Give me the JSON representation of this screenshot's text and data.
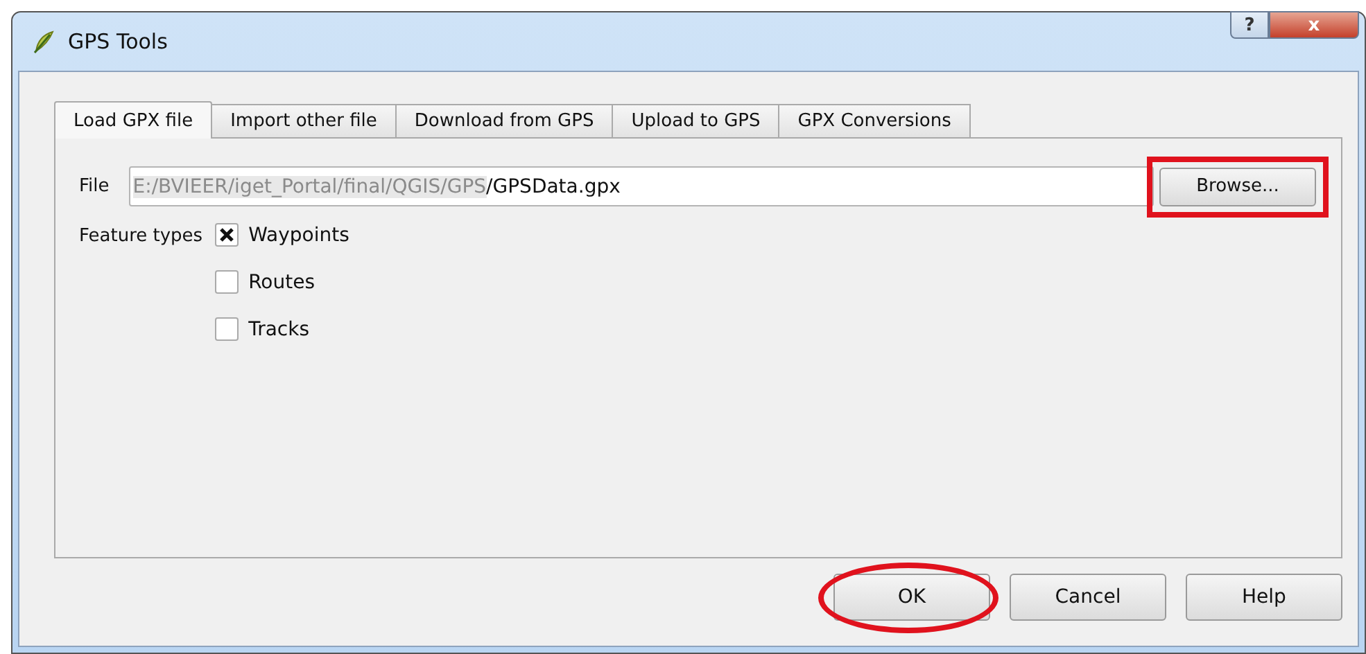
{
  "window": {
    "title": "GPS Tools",
    "controls": [
      {
        "kind": "help",
        "label": "?"
      },
      {
        "kind": "close",
        "label": "x"
      }
    ]
  },
  "tabs": [
    {
      "label": "Load GPX file",
      "selected": true
    },
    {
      "label": "Import other file",
      "selected": false
    },
    {
      "label": "Download from GPS",
      "selected": false
    },
    {
      "label": "Upload to GPS",
      "selected": false
    },
    {
      "label": "GPX Conversions",
      "selected": false
    }
  ],
  "file": {
    "label": "File",
    "value_dimmed": "E:/BVIEER/iget_Portal/final/QGIS/GPS",
    "value": "/GPSData.gpx",
    "button": {
      "label": "Browse...",
      "boxed": true
    }
  },
  "feature_types": {
    "label": "Feature types",
    "options": [
      {
        "label": "Waypoints",
        "checked": true
      },
      {
        "label": "Routes",
        "checked": false
      },
      {
        "label": "Tracks",
        "checked": false
      }
    ]
  },
  "buttons": [
    {
      "label": "OK",
      "circled": true
    },
    {
      "label": "Cancel",
      "circled": false
    },
    {
      "label": "Help",
      "circled": false
    }
  ]
}
